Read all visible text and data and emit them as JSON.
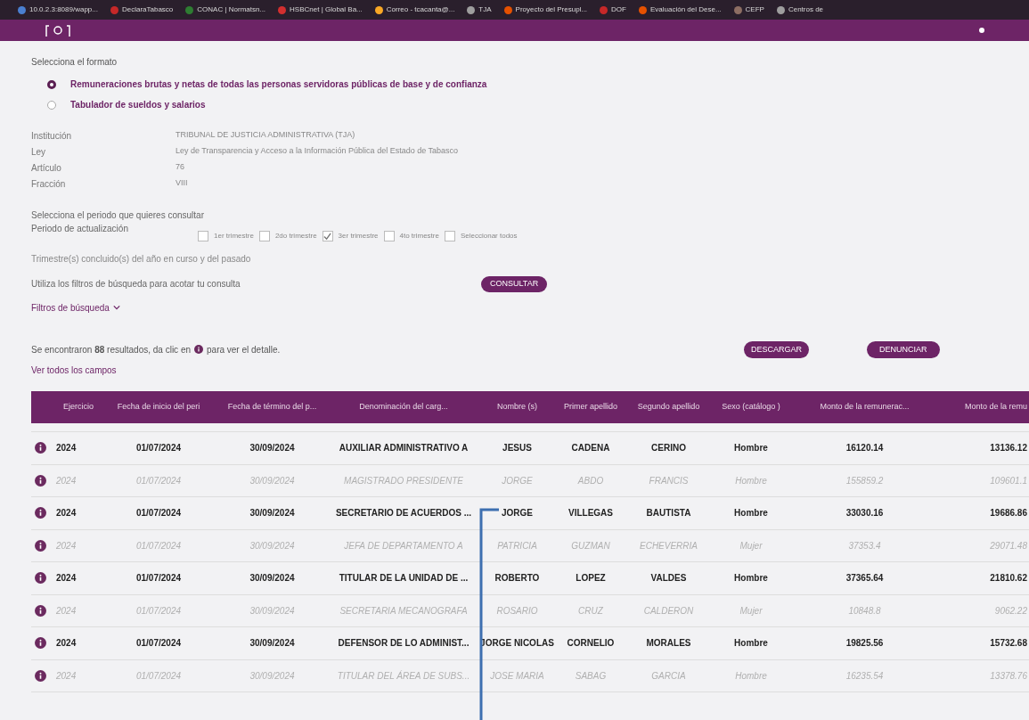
{
  "bookmarks": [
    {
      "label": "10.0.2.3:8089/wapp..."
    },
    {
      "label": "DeclaraTabasco"
    },
    {
      "label": "CONAC | Normatsn..."
    },
    {
      "label": "HSBCnet | Global Ba..."
    },
    {
      "label": "Correo - tcacanta@..."
    },
    {
      "label": "TJA"
    },
    {
      "label": "Proyecto del Presupl..."
    },
    {
      "label": "DOF"
    },
    {
      "label": "Evaluación del Dese..."
    },
    {
      "label": "CEFP"
    },
    {
      "label": "Centros de"
    }
  ],
  "format": {
    "label": "Selecciona el formato",
    "options": [
      {
        "label": "Remuneraciones brutas y netas de todas las personas servidoras públicas de base y de confianza",
        "selected": true
      },
      {
        "label": "Tabulador de sueldos y salarios",
        "selected": false
      }
    ]
  },
  "info": [
    {
      "label": "Institución",
      "value": "TRIBUNAL DE JUSTICIA ADMINISTRATIVA (TJA)"
    },
    {
      "label": "Ley",
      "value": "Ley de Transparencia y Acceso a la Información Pública del Estado de Tabasco"
    },
    {
      "label": "Artículo",
      "value": "76"
    },
    {
      "label": "Fracción",
      "value": "VIII"
    }
  ],
  "period": {
    "prompt": "Selecciona el periodo que quieres consultar",
    "label": "Periodo de actualización",
    "options": [
      {
        "label": "1er trimestre",
        "checked": false
      },
      {
        "label": "2do trimestre",
        "checked": false
      },
      {
        "label": "3er trimestre",
        "checked": true
      },
      {
        "label": "4to trimestre",
        "checked": false
      },
      {
        "label": "Seleccionar todos",
        "checked": false
      }
    ],
    "note": "Trimestre(s) concluido(s) del año en curso y del pasado"
  },
  "filter_prompt": "Utiliza los filtros de búsqueda para acotar tu consulta",
  "consult_button": "CONSULTAR",
  "filters_toggle": "Filtros de búsqueda",
  "results": {
    "prefix": "Se encontraron **88** resultados, da clic en",
    "suffix": "para ver el detalle.",
    "download_button": "DESCARGAR",
    "report_button": "DENUNCIAR",
    "all_fields_link": "Ver todos los campos"
  },
  "table": {
    "columns": [
      "Ejercicio",
      "Fecha de inicio del peri",
      "Fecha de término del p...",
      "Denominación del carg...",
      "Nombre (s)",
      "Primer apellido",
      "Segundo apellido",
      "Sexo (catálogo )",
      "Monto de la remunerac...",
      "Monto de la remu"
    ],
    "rows": [
      {
        "dimmed": false,
        "cells": [
          "2024",
          "01/07/2024",
          "30/09/2024",
          "AUXILIAR ADMINISTRATIVO A",
          "JESUS",
          "CADENA",
          "CERINO",
          "Hombre",
          "16120.14",
          "13136.12"
        ]
      },
      {
        "dimmed": true,
        "cells": [
          "2024",
          "01/07/2024",
          "30/09/2024",
          "MAGISTRADO PRESIDENTE",
          "JORGE",
          "ABDO",
          "FRANCIS",
          "Hombre",
          "155859.2",
          "109601.1"
        ]
      },
      {
        "dimmed": false,
        "cells": [
          "2024",
          "01/07/2024",
          "30/09/2024",
          "SECRETARIO DE ACUERDOS ...",
          "JORGE",
          "VILLEGAS",
          "BAUTISTA",
          "Hombre",
          "33030.16",
          "19686.86"
        ]
      },
      {
        "dimmed": true,
        "cells": [
          "2024",
          "01/07/2024",
          "30/09/2024",
          "JEFA DE DEPARTAMENTO A",
          "PATRICIA",
          "GUZMAN",
          "ECHEVERRIA",
          "Mujer",
          "37353.4",
          "29071.48"
        ]
      },
      {
        "dimmed": false,
        "cells": [
          "2024",
          "01/07/2024",
          "30/09/2024",
          "TITULAR DE LA UNIDAD DE ...",
          "ROBERTO",
          "LOPEZ",
          "VALDES",
          "Hombre",
          "37365.64",
          "21810.62"
        ]
      },
      {
        "dimmed": true,
        "cells": [
          "2024",
          "01/07/2024",
          "30/09/2024",
          "SECRETARIA MECANOGRAFA",
          "ROSARIO",
          "CRUZ",
          "CALDERON",
          "Mujer",
          "10848.8",
          "9062.22"
        ]
      },
      {
        "dimmed": false,
        "cells": [
          "2024",
          "01/07/2024",
          "30/09/2024",
          "DEFENSOR DE LO ADMINIST...",
          "JORGE NICOLAS",
          "CORNELIO",
          "MORALES",
          "Hombre",
          "19825.56",
          "15732.68"
        ]
      },
      {
        "dimmed": true,
        "cells": [
          "2024",
          "01/07/2024",
          "30/09/2024",
          "TITULAR DEL ÁREA DE SUBS...",
          "JOSE MARIA",
          "SABAG",
          "GARCIA",
          "Hombre",
          "16235.54",
          "13378.76"
        ]
      }
    ]
  }
}
